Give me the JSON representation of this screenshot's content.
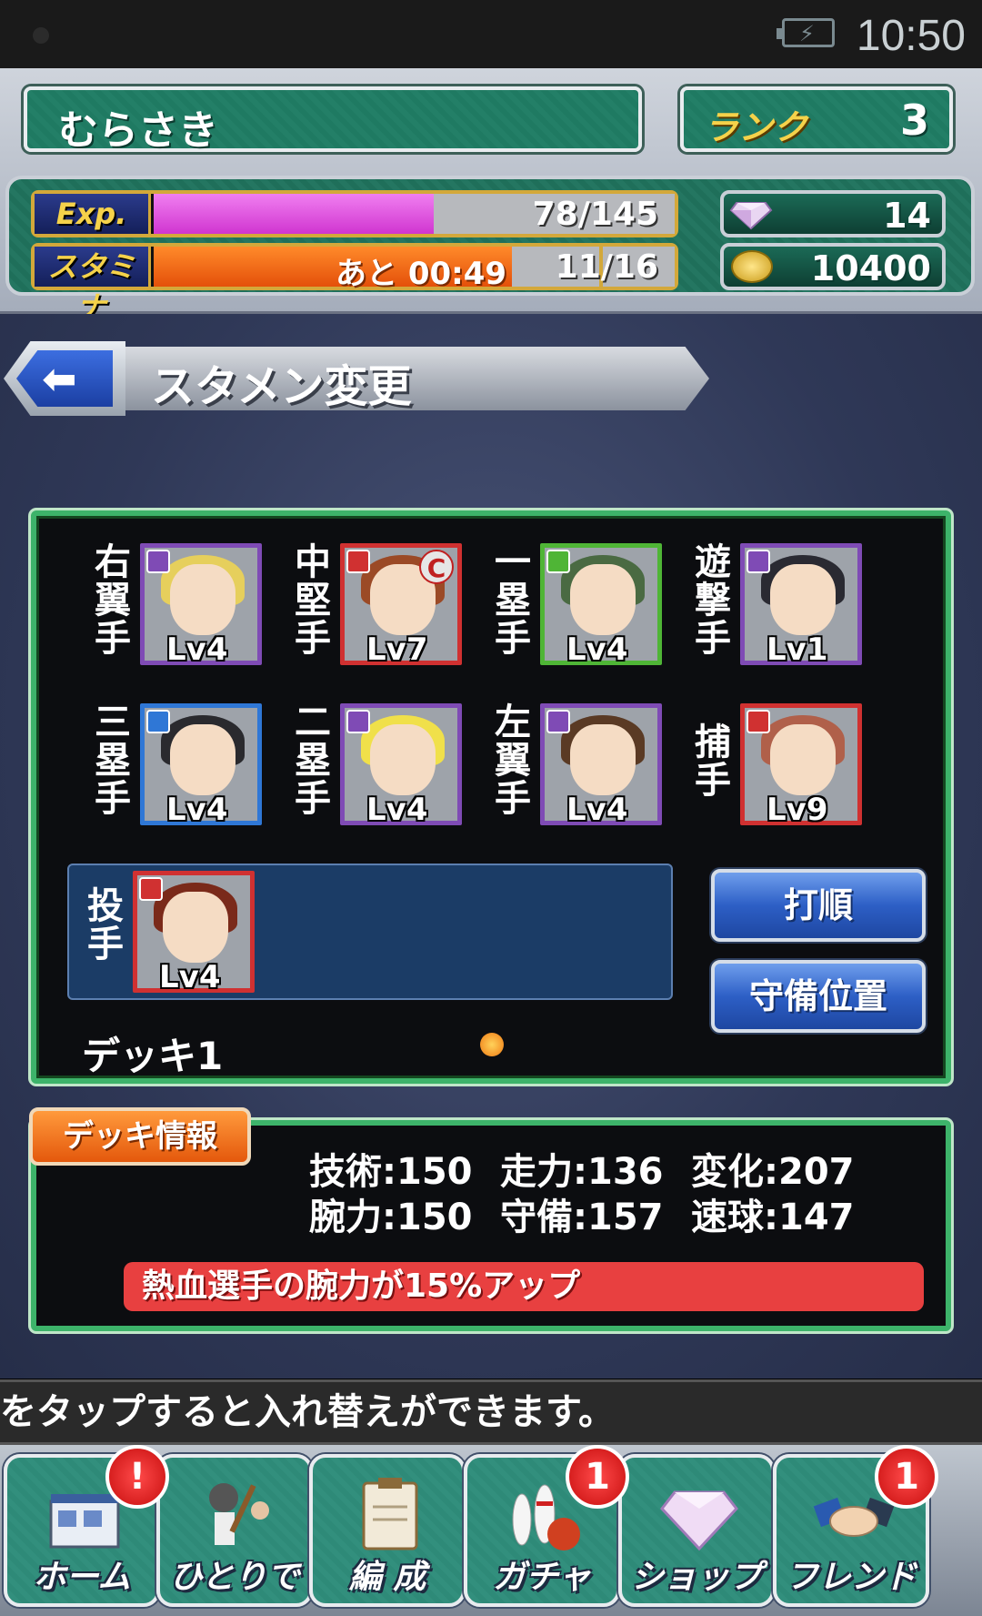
{
  "status_bar": {
    "time": "10:50"
  },
  "header": {
    "player_name": "むらさき",
    "rank_label": "ランク",
    "rank_value": "3",
    "exp": {
      "label": "Exp.",
      "value_text": "78/145",
      "fill_fraction": 0.5379
    },
    "stamina": {
      "label": "スタミナ",
      "recover_text": "あと 00:49",
      "value_text": "11/16",
      "fill_fraction": 0.6875
    },
    "gems": {
      "icon": "gem-icon",
      "value": "14"
    },
    "coins": {
      "icon": "coin-icon",
      "value": "10400"
    }
  },
  "title_bar": {
    "back_icon": "back-arrow-icon",
    "title": "スタメン変更"
  },
  "deck": {
    "positions": [
      {
        "label": "右翼手",
        "level": "Lv4",
        "border": "purple",
        "hair": "#e6cf5c"
      },
      {
        "label": "中堅手",
        "level": "Lv7",
        "border": "red",
        "hair": "#9b4a26",
        "captain": "C"
      },
      {
        "label": "一塁手",
        "level": "Lv4",
        "border": "green",
        "hair": "#4a6a42"
      },
      {
        "label": "遊撃手",
        "level": "Lv1",
        "border": "purple",
        "hair": "#2a2a32"
      },
      {
        "label": "三塁手",
        "level": "Lv4",
        "border": "blue",
        "hair": "#2a2a2e"
      },
      {
        "label": "二塁手",
        "level": "Lv4",
        "border": "purple",
        "hair": "#f0e04a"
      },
      {
        "label": "左翼手",
        "level": "Lv4",
        "border": "purple",
        "hair": "#5a3a24"
      },
      {
        "label": "捕手",
        "level": "Lv9",
        "border": "red",
        "hair": "#b0604a"
      }
    ],
    "pitcher": {
      "label": "投手",
      "level": "Lv4",
      "border": "red",
      "hair": "#7a2a1a"
    },
    "batting_order_button": "打順",
    "defense_position_button": "守備位置",
    "deck_name": "デッキ1"
  },
  "deck_info": {
    "tab_label": "デッキ情報",
    "stats": [
      {
        "text": "技術:150"
      },
      {
        "text": "走力:136"
      },
      {
        "text": "変化:207"
      },
      {
        "text": "腕力:150"
      },
      {
        "text": "守備:157"
      },
      {
        "text": "速球:147"
      }
    ],
    "bonus": "熱血選手の腕力が15%アップ"
  },
  "hint": "をタップすると入れ替えができます。",
  "nav": {
    "items": [
      {
        "label": "ホーム",
        "icon": "home-icon",
        "badge": "!"
      },
      {
        "label": "ひとりで",
        "icon": "solo-batter-icon",
        "badge": ""
      },
      {
        "label": "編 成",
        "icon": "clipboard-icon",
        "badge": ""
      },
      {
        "label": "ガチャ",
        "icon": "bowling-pins-icon",
        "badge": "1"
      },
      {
        "label": "ショップ",
        "icon": "diamond-icon",
        "badge": ""
      },
      {
        "label": "フレンド",
        "icon": "handshake-icon",
        "badge": "1"
      }
    ]
  }
}
